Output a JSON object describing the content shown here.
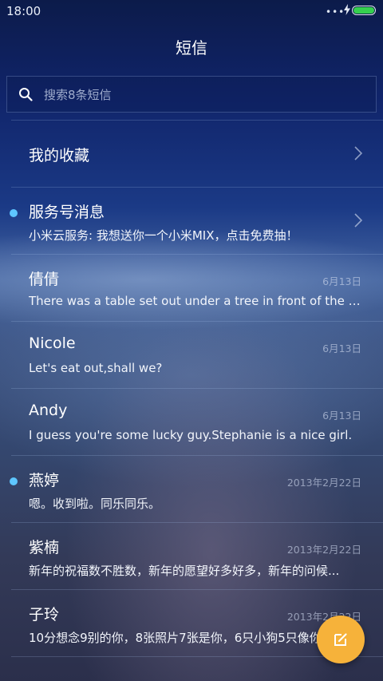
{
  "status_bar": {
    "time": "18:00",
    "signal_dots": "•••",
    "battery_color": "#35d04e"
  },
  "header": {
    "title": "短信"
  },
  "search": {
    "placeholder": "搜索8条短信"
  },
  "favorites": {
    "label": "我的收藏"
  },
  "conversations": [
    {
      "name": "服务号消息",
      "preview": "小米云服务: 我想送你一个小米MIX，点击免费抽！",
      "date": "",
      "unread": true
    },
    {
      "name": "倩倩",
      "preview": "There was a table set out under a tree in front of the ho...",
      "date": "6月13日",
      "unread": false
    },
    {
      "name": "Nicole",
      "preview": "Let's eat out,shall we?",
      "date": "6月13日",
      "unread": false
    },
    {
      "name": "Andy",
      "preview": "I guess you're some lucky guy.Stephanie is a nice girl.",
      "date": "6月13日",
      "unread": false
    },
    {
      "name": "燕婷",
      "preview": "嗯。收到啦。同乐同乐。",
      "date": "2013年2月22日",
      "unread": true
    },
    {
      "name": "紫楠",
      "preview": "新年的祝福数不胜数，新年的愿望好多好多，新年的问候...",
      "date": "2013年2月22日",
      "unread": false
    },
    {
      "name": "子玲",
      "preview": "10分想念9别的你，8张照片7张是你，6只小狗5只像你",
      "date": "2013年2月22日",
      "unread": false
    }
  ],
  "colors": {
    "accent_fab": "#f6b23a",
    "unread_dot": "#5ec6ff"
  },
  "icons": {
    "search": "search-icon",
    "compose": "compose-icon",
    "chevron": "chevron-right-icon"
  }
}
